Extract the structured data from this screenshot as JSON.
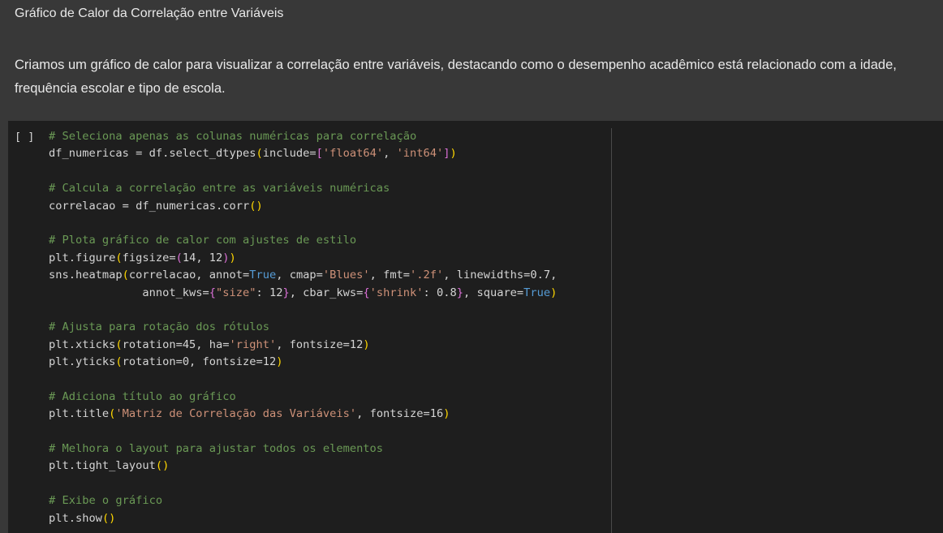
{
  "text_cell": {
    "heading": "Gráfico de Calor da Correlação entre Variáveis",
    "paragraph": "Criamos um gráfico de calor para visualizar a correlação entre variáveis, destacando como o desempenho acadêmico está relacionado com a idade, frequência escolar e tipo de escola."
  },
  "code_cell": {
    "run_indicator": "[ ]",
    "lines": [
      [
        {
          "t": "# Seleciona apenas as colunas numéricas para correlação",
          "c": "cm"
        }
      ],
      [
        {
          "t": "df_numericas = df.select_dtypes"
        },
        {
          "t": "(",
          "c": "p1"
        },
        {
          "t": "include="
        },
        {
          "t": "[",
          "c": "p2"
        },
        {
          "t": "'float64'",
          "c": "st"
        },
        {
          "t": ", "
        },
        {
          "t": "'int64'",
          "c": "st"
        },
        {
          "t": "]",
          "c": "p2"
        },
        {
          "t": ")",
          "c": "p1"
        }
      ],
      [],
      [
        {
          "t": "# Calcula a correlação entre as variáveis numéricas",
          "c": "cm"
        }
      ],
      [
        {
          "t": "correlacao = df_numericas.corr"
        },
        {
          "t": "()",
          "c": "p1"
        }
      ],
      [],
      [
        {
          "t": "# Plota gráfico de calor com ajustes de estilo",
          "c": "cm"
        }
      ],
      [
        {
          "t": "plt.figure"
        },
        {
          "t": "(",
          "c": "p1"
        },
        {
          "t": "figsize="
        },
        {
          "t": "(",
          "c": "p2"
        },
        {
          "t": "14, 12"
        },
        {
          "t": ")",
          "c": "p2"
        },
        {
          "t": ")",
          "c": "p1"
        }
      ],
      [
        {
          "t": "sns.heatmap"
        },
        {
          "t": "(",
          "c": "p1"
        },
        {
          "t": "correlacao, annot="
        },
        {
          "t": "True",
          "c": "kw"
        },
        {
          "t": ", cmap="
        },
        {
          "t": "'Blues'",
          "c": "st"
        },
        {
          "t": ", fmt="
        },
        {
          "t": "'.2f'",
          "c": "st"
        },
        {
          "t": ", linewidths=0.7,"
        }
      ],
      [
        {
          "t": "              annot_kws="
        },
        {
          "t": "{",
          "c": "p2"
        },
        {
          "t": "\"size\"",
          "c": "st"
        },
        {
          "t": ": 12"
        },
        {
          "t": "}",
          "c": "p2"
        },
        {
          "t": ", cbar_kws="
        },
        {
          "t": "{",
          "c": "p2"
        },
        {
          "t": "'shrink'",
          "c": "st"
        },
        {
          "t": ": 0.8"
        },
        {
          "t": "}",
          "c": "p2"
        },
        {
          "t": ", square="
        },
        {
          "t": "True",
          "c": "kw"
        },
        {
          "t": ")",
          "c": "p1"
        }
      ],
      [],
      [
        {
          "t": "# Ajusta para rotação dos rótulos",
          "c": "cm"
        }
      ],
      [
        {
          "t": "plt.xticks"
        },
        {
          "t": "(",
          "c": "p1"
        },
        {
          "t": "rotation=45, ha="
        },
        {
          "t": "'right'",
          "c": "st"
        },
        {
          "t": ", fontsize=12"
        },
        {
          "t": ")",
          "c": "p1"
        }
      ],
      [
        {
          "t": "plt.yticks"
        },
        {
          "t": "(",
          "c": "p1"
        },
        {
          "t": "rotation=0, fontsize=12"
        },
        {
          "t": ")",
          "c": "p1"
        }
      ],
      [],
      [
        {
          "t": "# Adiciona título ao gráfico",
          "c": "cm"
        }
      ],
      [
        {
          "t": "plt.title"
        },
        {
          "t": "(",
          "c": "p1"
        },
        {
          "t": "'Matriz de Correlação das Variáveis'",
          "c": "st"
        },
        {
          "t": ", fontsize=16"
        },
        {
          "t": ")",
          "c": "p1"
        }
      ],
      [],
      [
        {
          "t": "# Melhora o layout para ajustar todos os elementos",
          "c": "cm"
        }
      ],
      [
        {
          "t": "plt.tight_layout"
        },
        {
          "t": "()",
          "c": "p1"
        }
      ],
      [],
      [
        {
          "t": "# Exibe o gráfico",
          "c": "cm"
        }
      ],
      [
        {
          "t": "plt.show"
        },
        {
          "t": "()",
          "c": "p1"
        }
      ]
    ]
  },
  "colors": {
    "background": "#383838",
    "code_background": "#1e1e1e",
    "comment": "#6a9955",
    "string": "#ce9178",
    "keyword": "#569cd6",
    "bracket_level1": "#ffd700",
    "bracket_level2": "#da70d6"
  }
}
